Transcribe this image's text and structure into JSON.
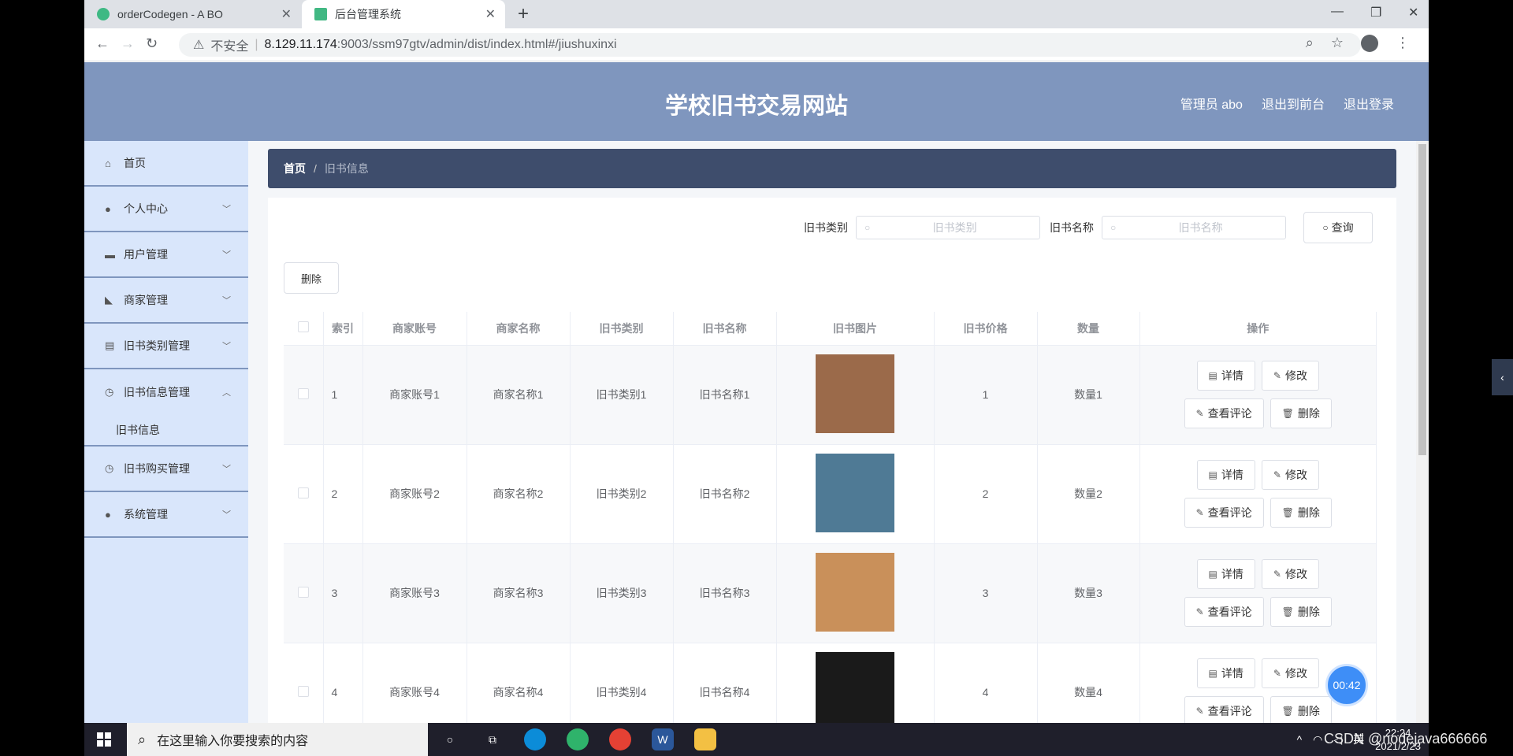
{
  "browser": {
    "tabs": [
      {
        "label": "orderCodegen - A BO",
        "close": "✕"
      },
      {
        "label": "后台管理系统",
        "close": "✕"
      }
    ],
    "new_tab": "+",
    "omni": {
      "warning": "⚠",
      "insecure": "不安全",
      "sep": "|",
      "host": "8.129.11.174",
      "path": ":9003/ssm97gtv/admin/dist/index.html#/jiushuxinxi"
    }
  },
  "header": {
    "title": "学校旧书交易网站",
    "links": [
      "管理员 abo",
      "退出到前台",
      "退出登录"
    ]
  },
  "sidebar": {
    "items": [
      {
        "label": "首页",
        "icon": "home-icon",
        "glyph": "⌂",
        "chevron": ""
      },
      {
        "label": "个人中心",
        "icon": "user-icon",
        "glyph": "●",
        "chevron": "﹀"
      },
      {
        "label": "用户管理",
        "icon": "briefcase-icon",
        "glyph": "▬",
        "chevron": "﹀"
      },
      {
        "label": "商家管理",
        "icon": "shop-icon",
        "glyph": "◣",
        "chevron": "﹀"
      },
      {
        "label": "旧书类别管理",
        "icon": "document-icon",
        "glyph": "▤",
        "chevron": "﹀"
      },
      {
        "label": "旧书信息管理",
        "icon": "clock-icon",
        "glyph": "◷",
        "chevron": "︿"
      },
      {
        "label": "旧书购买管理",
        "icon": "time-icon",
        "glyph": "◷",
        "chevron": "﹀"
      },
      {
        "label": "系统管理",
        "icon": "user-icon",
        "glyph": "●",
        "chevron": "﹀"
      }
    ],
    "sub_item": "旧书信息"
  },
  "breadcrumb": {
    "home": "首页",
    "sep": "/",
    "current": "旧书信息"
  },
  "search": {
    "category_label": "旧书类别",
    "category_placeholder": "旧书类别",
    "name_label": "旧书名称",
    "name_placeholder": "旧书名称",
    "query_button": "查询"
  },
  "delete_button": "删除",
  "table": {
    "headers": [
      "索引",
      "商家账号",
      "商家名称",
      "旧书类别",
      "旧书名称",
      "旧书图片",
      "旧书价格",
      "数量",
      "操作"
    ],
    "rows": [
      {
        "index": "1",
        "account": "商家账号1",
        "name": "商家名称1",
        "category": "旧书类别1",
        "book": "旧书名称1",
        "price": "1",
        "qty": "数量1",
        "img_color": "#9b6a4a"
      },
      {
        "index": "2",
        "account": "商家账号2",
        "name": "商家名称2",
        "category": "旧书类别2",
        "book": "旧书名称2",
        "price": "2",
        "qty": "数量2",
        "img_color": "#4f7a95"
      },
      {
        "index": "3",
        "account": "商家账号3",
        "name": "商家名称3",
        "category": "旧书类别3",
        "book": "旧书名称3",
        "price": "3",
        "qty": "数量3",
        "img_color": "#c9905a"
      },
      {
        "index": "4",
        "account": "商家账号4",
        "name": "商家名称4",
        "category": "旧书类别4",
        "book": "旧书名称4",
        "price": "4",
        "qty": "数量4",
        "img_color": "#1a1a1a"
      }
    ],
    "ops": {
      "detail": "详情",
      "edit": "修改",
      "comments": "查看评论",
      "delete": "删除"
    }
  },
  "timer": "00:42",
  "taskbar": {
    "search_placeholder": "在这里输入你要搜索的内容",
    "ime": "英",
    "time": "22:24",
    "date": "2021/2/23"
  },
  "watermark": "CSDN @nodejava666666",
  "colors": {
    "header": "#7f96be",
    "sidebar": "#d9e6fb",
    "breadcrumb": "#3e4d6c",
    "timer": "#3e8ef7"
  }
}
